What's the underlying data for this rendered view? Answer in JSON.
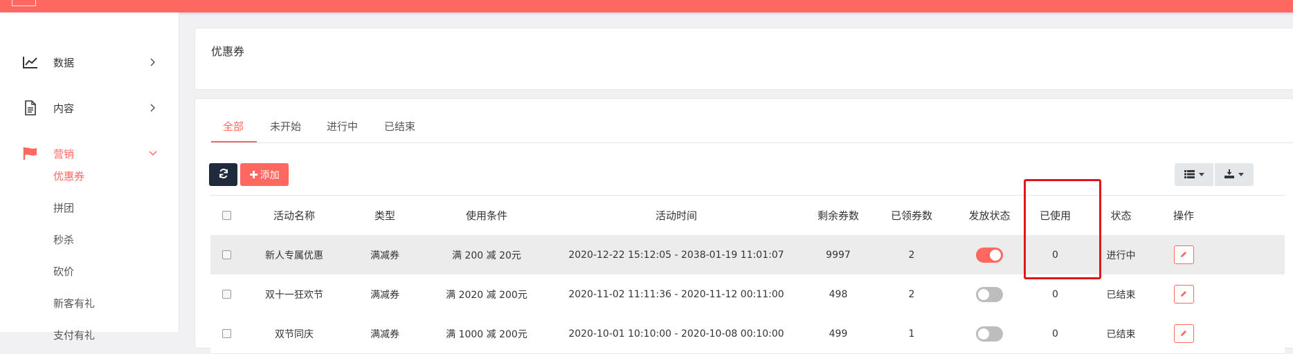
{
  "colors": {
    "accent": "#ff6860",
    "dark_button": "#1f2b3c",
    "highlight": "#e0161b"
  },
  "sidebar": {
    "items": [
      {
        "label": "数据",
        "icon": "line-chart-icon"
      },
      {
        "label": "内容",
        "icon": "document-icon"
      },
      {
        "label": "营销",
        "icon": "flag-icon",
        "active": true
      }
    ],
    "subitems": [
      {
        "label": "优惠券",
        "active": true
      },
      {
        "label": "拼团"
      },
      {
        "label": "秒杀"
      },
      {
        "label": "砍价"
      },
      {
        "label": "新客有礼"
      },
      {
        "label": "支付有礼"
      }
    ]
  },
  "page": {
    "title": "优惠券"
  },
  "tabs": [
    {
      "label": "全部",
      "active": true
    },
    {
      "label": "未开始"
    },
    {
      "label": "进行中"
    },
    {
      "label": "已结束"
    }
  ],
  "toolbar": {
    "add_label": "添加",
    "add_icon": "plus-icon",
    "refresh_icon": "refresh-icon",
    "view_icon": "list-icon",
    "export_icon": "download-icon"
  },
  "table": {
    "columns": [
      "活动名称",
      "类型",
      "使用条件",
      "活动时间",
      "剩余券数",
      "已领券数",
      "发放状态",
      "已使用",
      "状态",
      "操作"
    ],
    "rows": [
      {
        "name": "新人专属优惠",
        "type": "满减券",
        "condition": "满 200 减 20元",
        "time": "2020-12-22 15:12:05 - 2038-01-19 11:01:07",
        "remaining": "9997",
        "received": "2",
        "issuing": true,
        "used": "0",
        "status": "进行中"
      },
      {
        "name": "双十一狂欢节",
        "type": "满减券",
        "condition": "满 2020 减 200元",
        "time": "2020-11-02 11:11:36 - 2020-11-12 00:11:00",
        "remaining": "498",
        "received": "2",
        "issuing": false,
        "used": "0",
        "status": "已结束"
      },
      {
        "name": "双节同庆",
        "type": "满减券",
        "condition": "满 1000 减 200元",
        "time": "2020-10-01 10:10:00 - 2020-10-08 00:10:00",
        "remaining": "499",
        "received": "1",
        "issuing": false,
        "used": "0",
        "status": "已结束"
      }
    ]
  }
}
